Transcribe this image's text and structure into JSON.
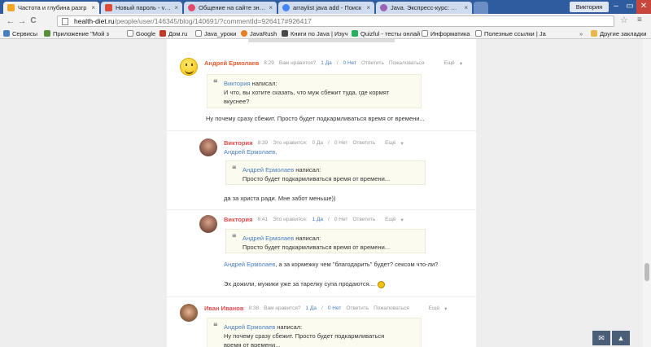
{
  "browser": {
    "tabs": [
      {
        "label": "Частота и глубина разгр",
        "color": "#f5a623",
        "active": true
      },
      {
        "label": "Новый пароль - vikky",
        "color": "#dd4b39"
      },
      {
        "label": "Общение на сайте знако",
        "color": "#e34b6b"
      },
      {
        "label": "arraylist java add - Поиск",
        "color": "#4285f4"
      },
      {
        "label": "Java. Экспресс-курс: Сли",
        "color": "#9a63b5"
      }
    ],
    "close_glyph": "×",
    "user_badge": "Виктория",
    "window_controls": [
      "–",
      "▭",
      "✕"
    ],
    "nav": {
      "back": "←",
      "forward": "→",
      "reload": "C"
    },
    "address": {
      "host": "health-diet.ru",
      "path": "/people/user/146345/blog/140691/?commentId=926417#926417"
    },
    "star_icon": "☆",
    "menu_icon": "≡"
  },
  "bookmarks": {
    "items": [
      {
        "label": "Сервисы",
        "color": "#4a7fbf"
      },
      {
        "label": "Приложение \"Мой з",
        "color": "#5a8f3a"
      },
      {
        "label": "Google",
        "color": "#888"
      },
      {
        "label": "Дом.ru",
        "color": "#c0392b"
      },
      {
        "label": "Java_уроки",
        "color": "#888"
      },
      {
        "label": "JavaRush",
        "color": "#e67e22"
      },
      {
        "label": "Книги по Java | Изуч",
        "color": "#4a4a4a"
      },
      {
        "label": "Quizful - тесты онлай",
        "color": "#27ae60"
      },
      {
        "label": "Информатика",
        "color": "#888"
      },
      {
        "label": "Полезные ссылки | Ja",
        "color": "#888"
      }
    ],
    "more": "»",
    "other": "Другие закладки"
  },
  "comments": [
    {
      "author": "Андрей Ермолаев",
      "time": "8:29",
      "likes_label": "Вам нравится?",
      "yes": "1 Да",
      "no": "0 Нет",
      "reply": "Ответить",
      "complain": "Пожаловаться",
      "more": "Ещё",
      "quote_author": "Виктория",
      "quote_wrote": "написал:",
      "quote_line1": "И что, вы хотите сказать, что муж сбежит туда, где кормят",
      "quote_line2": "вкуснее?",
      "body": "Ну почему сразу сбежит. Просто будет подкармливаться время от времени..."
    },
    {
      "author": "Виктория",
      "time": "8:39",
      "likes_label": "Это нравится:",
      "yes": "0 Да",
      "no": "0 Нет",
      "reply": "Ответить",
      "more": "Ещё",
      "mention": "Андрей Ермолаев,",
      "quote_author": "Андрей Ермолаев",
      "quote_wrote": "написал:",
      "quote_line1": "Просто будет подкармливаться время от времени...",
      "body": "да за христа ради. Мне забот меньше))"
    },
    {
      "author": "Виктория",
      "time": "8:41",
      "likes_label": "Это нравится:",
      "yes": "1 Да",
      "no": "0 Нет",
      "reply": "Ответить",
      "more": "Ещё",
      "quote_author": "Андрей Ермолаев",
      "quote_wrote": "написал:",
      "quote_line1": "Просто будет подкармливаться время от времени...",
      "mention": "Андрей Ермолаев",
      "body_rest": ", а за кормежку чем \"благодарить\" будет? сексом что-ли?",
      "body2": "Эх дожили, мужики уже за тарелку супа продаются...."
    },
    {
      "author": "Иван Иванов",
      "time": "8:38",
      "likes_label": "Вам нравится?",
      "yes": "1 Да",
      "no": "0 Нет",
      "reply": "Ответить",
      "complain": "Пожаловаться",
      "more": "Ещё",
      "quote_author": "Андрей Ермолаев",
      "quote_wrote": "написал:",
      "quote_line1": "Ну почему сразу сбежит. Просто будет подкармливаться",
      "quote_line2": "время от времени..."
    }
  ],
  "widgets": {
    "chat_icon": "✉",
    "bell_icon": "▲"
  }
}
